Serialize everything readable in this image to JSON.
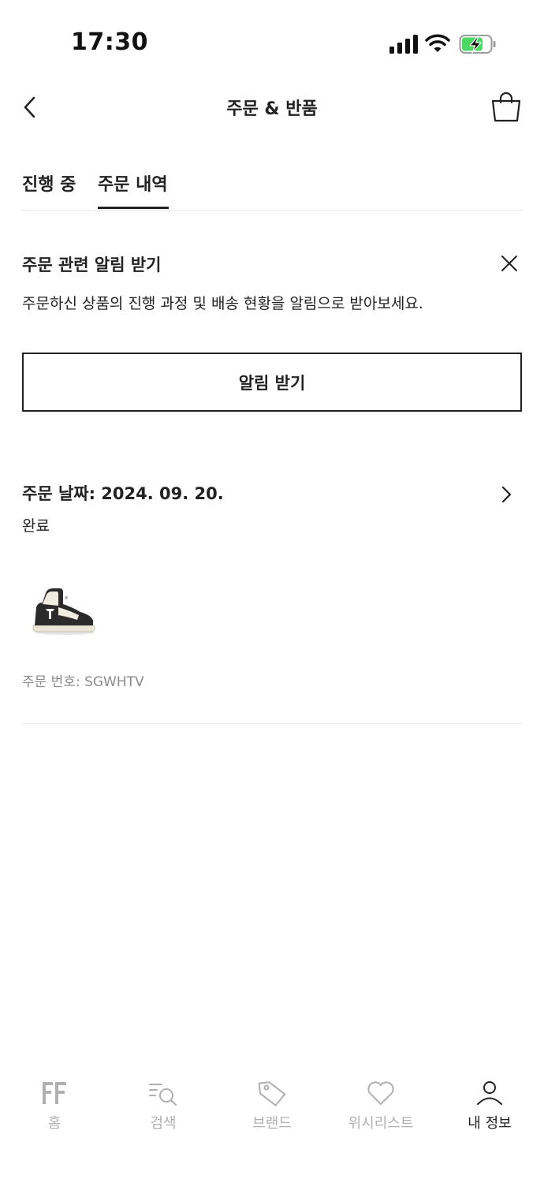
{
  "status_bar": {
    "time": "17:30",
    "icons": [
      "cellular-signal-icon",
      "wifi-icon",
      "battery-charging-icon"
    ],
    "battery_color": "#4cd964"
  },
  "header": {
    "title": "주문 & 반품",
    "back_icon": "chevron-left-icon",
    "cart_icon": "shopping-bag-icon"
  },
  "tabs": [
    {
      "label": "진행 중",
      "active": false
    },
    {
      "label": "주문 내역",
      "active": true
    }
  ],
  "notification": {
    "title": "주문 관련 알림 받기",
    "description": "주문하신 상품의 진행 과정 및 배송 현황을 알림으로 받아보세요.",
    "button_label": "알림 받기",
    "close_icon": "close-icon"
  },
  "order": {
    "date_label": "주문 날짜: 2024. 09. 20.",
    "status": "완료",
    "order_number": "주문 번호: SGWHTV",
    "thumbnail_icon": "sneaker-product-image",
    "chevron_icon": "chevron-right-icon"
  },
  "bottom_nav": {
    "items": [
      {
        "label": "홈",
        "icon": "farfetch-logo-icon",
        "active": false
      },
      {
        "label": "검색",
        "icon": "search-icon",
        "active": false
      },
      {
        "label": "브랜드",
        "icon": "tag-icon",
        "active": false
      },
      {
        "label": "위시리스트",
        "icon": "heart-icon",
        "active": false
      },
      {
        "label": "내 정보",
        "icon": "user-icon",
        "active": true
      }
    ],
    "inactive_color": "#b0b0b0",
    "active_color": "#222222"
  }
}
